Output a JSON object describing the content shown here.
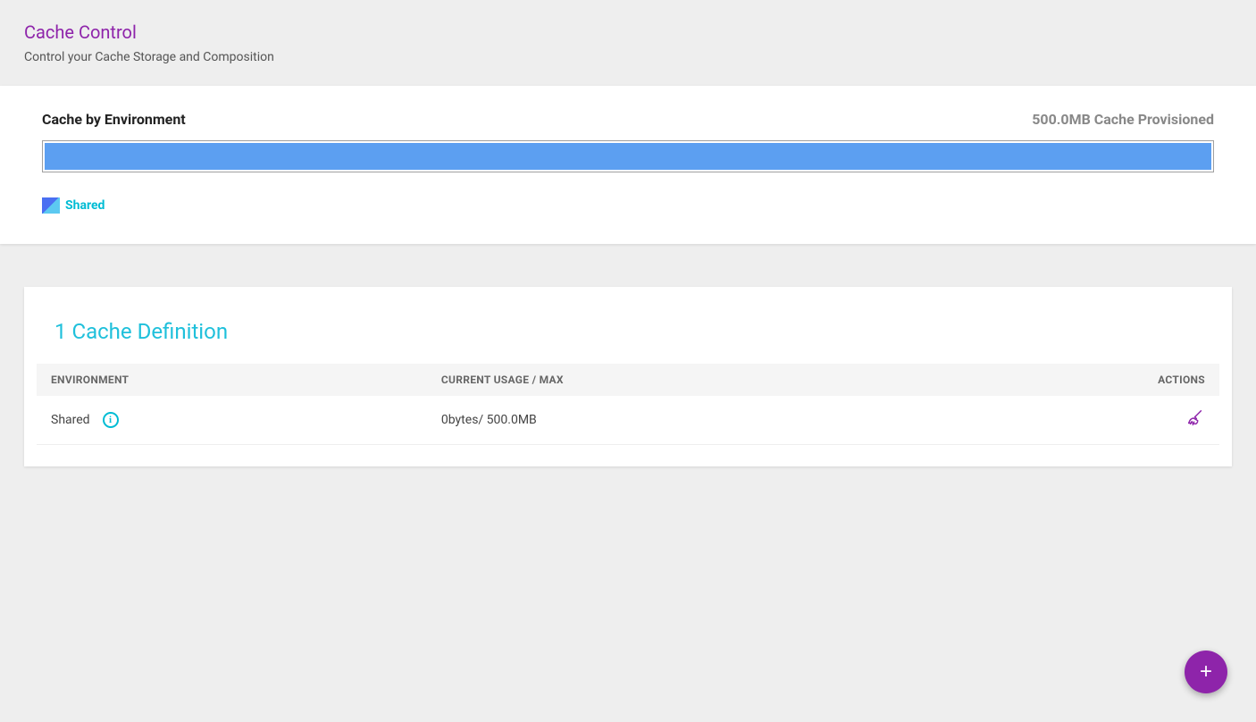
{
  "header": {
    "title": "Cache Control",
    "subtitle": "Control your Cache Storage and Composition"
  },
  "overview": {
    "section_title": "Cache by Environment",
    "provisioned": "500.0MB Cache Provisioned",
    "legend_label": "Shared"
  },
  "chart_data": {
    "type": "bar",
    "title": "Cache by Environment",
    "categories": [
      "Shared"
    ],
    "values": [
      500.0
    ],
    "total": 500.0,
    "unit": "MB"
  },
  "definitions": {
    "title": "1 Cache Definition",
    "columns": {
      "environment": "ENVIRONMENT",
      "usage": "CURRENT USAGE / MAX",
      "actions": "ACTIONS"
    },
    "rows": [
      {
        "environment": "Shared",
        "usage": "0bytes/ 500.0MB"
      }
    ]
  },
  "fab_label": "+"
}
